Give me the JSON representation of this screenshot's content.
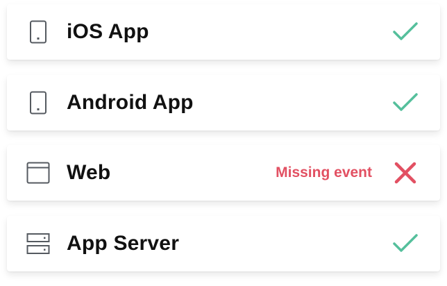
{
  "colors": {
    "success": "#55bf9c",
    "error": "#e25062",
    "icon_stroke": "#555a60",
    "text": "#111111"
  },
  "platforms": [
    {
      "label": "iOS App",
      "icon": "mobile-device-icon",
      "status": "ok",
      "status_text": ""
    },
    {
      "label": "Android App",
      "icon": "mobile-device-icon",
      "status": "ok",
      "status_text": ""
    },
    {
      "label": "Web",
      "icon": "browser-window-icon",
      "status": "error",
      "status_text": "Missing event"
    },
    {
      "label": "App Server",
      "icon": "server-icon",
      "status": "ok",
      "status_text": ""
    }
  ]
}
